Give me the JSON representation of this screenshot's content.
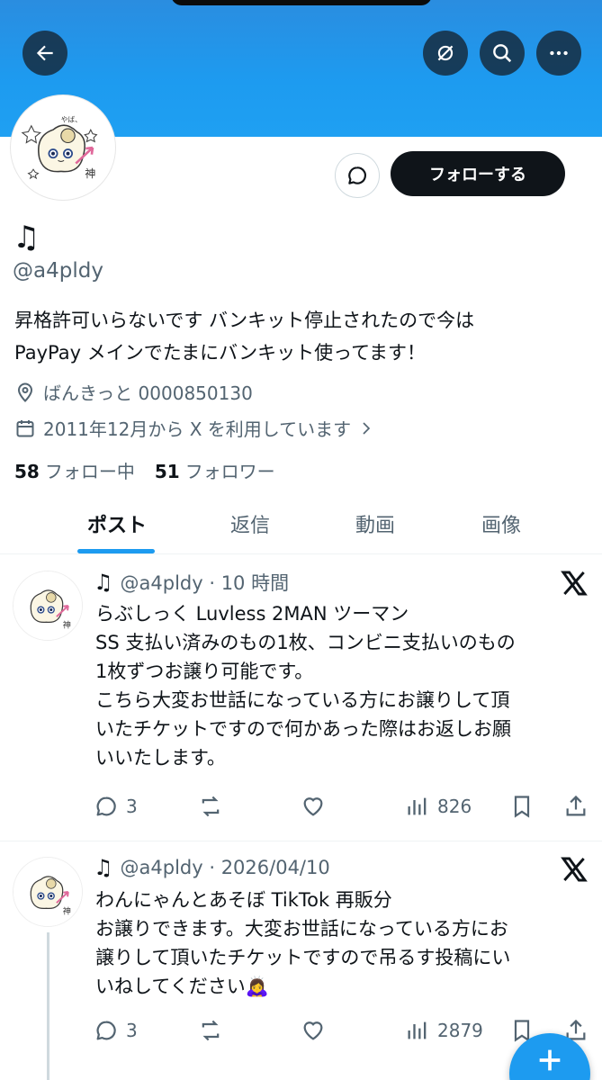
{
  "profile": {
    "display_name": "♫",
    "handle": "@a4pldy",
    "bio_line1": "昇格許可いらないです バンキット停止されたので今は",
    "bio_line2": "PayPay メインでたまにバンキット使ってます！",
    "location": "ばんきっと 0000850130",
    "joined": "2011年12月から X を利用しています",
    "following_count": "58",
    "following_label": "フォロー中",
    "followers_count": "51",
    "followers_label": "フォロワー",
    "follow_button": "フォローする"
  },
  "icons": {
    "back": "back-arrow-icon",
    "grok": "grok-icon",
    "search": "search-icon",
    "more": "more-icon",
    "message": "message-bubble-icon",
    "location": "location-pin-icon",
    "calendar": "calendar-icon",
    "x_logo": "x-logo-icon",
    "reply": "reply-icon",
    "repost": "repost-icon",
    "like": "like-icon",
    "views": "views-icon",
    "bookmark": "bookmark-icon",
    "share": "share-icon",
    "compose": "compose-plus-icon"
  },
  "tabs": [
    {
      "label": "ポスト",
      "active": true
    },
    {
      "label": "返信",
      "active": false
    },
    {
      "label": "動画",
      "active": false
    },
    {
      "label": "画像",
      "active": false
    }
  ],
  "posts": [
    {
      "name": "♫",
      "handle_time": "@a4pldy · 10 時間",
      "text": "らぶしっく Luvless 2MAN ツーマン\nSS 支払い済みのもの1枚、コンビニ支払いのもの\n1枚ずつお譲り可能です。\nこちら大変お世話になっている方にお譲りして頂\nいたチケットですので何かあった際はお返しお願\nいいたします。",
      "replies": "3",
      "reposts": "",
      "likes": "",
      "views": "826"
    },
    {
      "name": "♫",
      "handle_time": "@a4pldy · 2026/04/10",
      "text": "わんにゃんとあそぼ TikTok 再販分\nお譲りできます。大変お世話になっている方にお\n譲りして頂いたチケットですので吊るす投稿にい\nいねしてください🙇‍♀️",
      "replies": "3",
      "reposts": "",
      "likes": "",
      "views": "2879"
    }
  ],
  "colors": {
    "accent": "#1d9bf0",
    "text": "#0f1419",
    "secondary": "#536471",
    "follow_bg": "#0f1419"
  }
}
